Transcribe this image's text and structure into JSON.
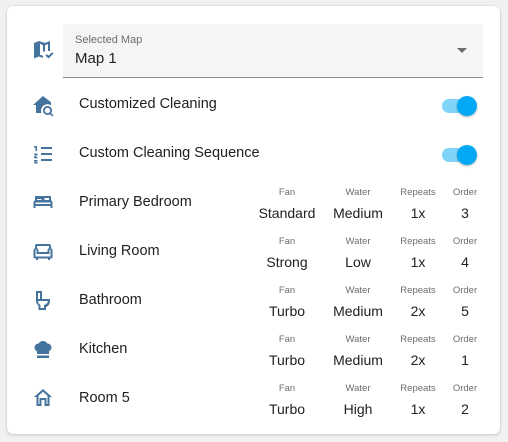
{
  "map_select": {
    "label": "Selected Map",
    "value": "Map 1",
    "icon": "map-check-icon"
  },
  "toggles": [
    {
      "label": "Customized Cleaning",
      "on": true,
      "icon": "home-search-icon"
    },
    {
      "label": "Custom Cleaning Sequence",
      "on": true,
      "icon": "format-list-numbered-icon"
    }
  ],
  "attr_labels": {
    "fan": "Fan",
    "water": "Water",
    "repeats": "Repeats",
    "order": "Order"
  },
  "rooms": [
    {
      "name": "Primary Bedroom",
      "icon": "bed-icon",
      "fan": "Standard",
      "water": "Medium",
      "repeats": "1x",
      "order": "3"
    },
    {
      "name": "Living Room",
      "icon": "sofa-icon",
      "fan": "Strong",
      "water": "Low",
      "repeats": "1x",
      "order": "4"
    },
    {
      "name": "Bathroom",
      "icon": "toilet-icon",
      "fan": "Turbo",
      "water": "Medium",
      "repeats": "2x",
      "order": "5"
    },
    {
      "name": "Kitchen",
      "icon": "chef-hat-icon",
      "fan": "Turbo",
      "water": "Medium",
      "repeats": "2x",
      "order": "1"
    },
    {
      "name": "Room 5",
      "icon": "home-outline-icon",
      "fan": "Turbo",
      "water": "High",
      "repeats": "1x",
      "order": "2"
    }
  ],
  "colors": {
    "icon": "#44739e",
    "accent": "#03a9f4",
    "card": "#ffffff",
    "background": "#f1f1f4"
  }
}
